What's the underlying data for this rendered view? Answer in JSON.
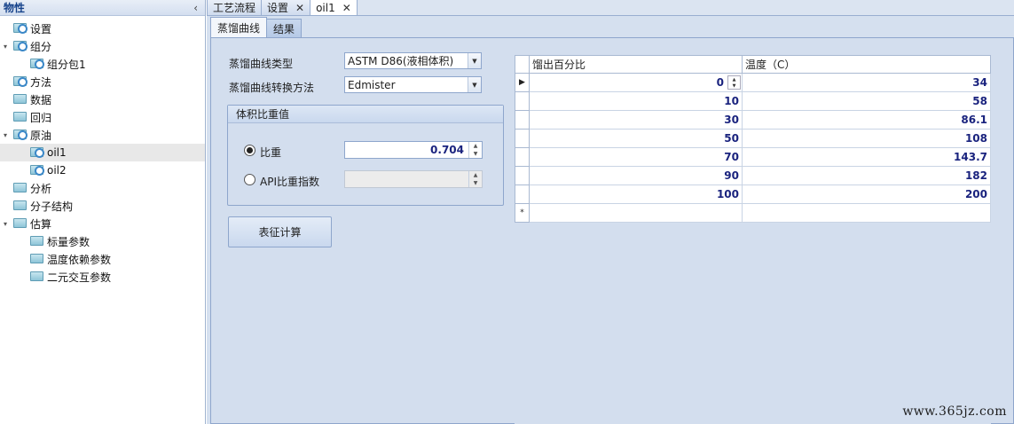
{
  "left_panel": {
    "title": "物性",
    "collapse_glyph": "‹",
    "tree": [
      {
        "label": "设置",
        "level": 0,
        "expander": "",
        "icon": "folder-gear-icon"
      },
      {
        "label": "组分",
        "level": 0,
        "expander": "▾",
        "icon": "folder-gear-icon"
      },
      {
        "label": "组分包1",
        "level": 1,
        "expander": "",
        "icon": "folder-gear-icon"
      },
      {
        "label": "方法",
        "level": 0,
        "expander": "",
        "icon": "folder-gear-icon"
      },
      {
        "label": "数据",
        "level": 0,
        "expander": "",
        "icon": "folder-icon"
      },
      {
        "label": "回归",
        "level": 0,
        "expander": "",
        "icon": "folder-icon"
      },
      {
        "label": "原油",
        "level": 0,
        "expander": "▾",
        "icon": "folder-gear-icon"
      },
      {
        "label": "oil1",
        "level": 1,
        "expander": "",
        "icon": "folder-gear-icon",
        "selected": true
      },
      {
        "label": "oil2",
        "level": 1,
        "expander": "",
        "icon": "folder-gear-icon"
      },
      {
        "label": "分析",
        "level": 0,
        "expander": "",
        "icon": "folder-icon"
      },
      {
        "label": "分子结构",
        "level": 0,
        "expander": "",
        "icon": "folder-icon"
      },
      {
        "label": "估算",
        "level": 0,
        "expander": "▾",
        "icon": "folder-icon"
      },
      {
        "label": "标量参数",
        "level": 1,
        "expander": "",
        "icon": "folder-icon"
      },
      {
        "label": "温度依赖参数",
        "level": 1,
        "expander": "",
        "icon": "folder-icon"
      },
      {
        "label": "二元交互参数",
        "level": 1,
        "expander": "",
        "icon": "folder-icon"
      }
    ]
  },
  "doc_tabs": [
    {
      "label": "工艺流程",
      "closable": false,
      "active": false
    },
    {
      "label": "设置",
      "closable": true,
      "active": false
    },
    {
      "label": "oil1",
      "closable": true,
      "active": true
    }
  ],
  "close_glyph": "✕",
  "sub_tabs": [
    {
      "label": "蒸馏曲线",
      "active": true
    },
    {
      "label": "结果",
      "active": false
    }
  ],
  "form": {
    "curve_type_label": "蒸馏曲线类型",
    "curve_type_value": "ASTM D86(液相体积)",
    "convert_method_label": "蒸馏曲线转换方法",
    "convert_method_value": "Edmister",
    "group_title": "体积比重值",
    "sg_label": "比重",
    "sg_value": "0.704",
    "sg_selected": true,
    "api_label": "API比重指数",
    "api_value": "",
    "calc_button": "表征计算"
  },
  "grid": {
    "columns": [
      "馏出百分比",
      "温度（C）"
    ],
    "rows": [
      {
        "marker": "▶",
        "pct": "0",
        "temp": "34",
        "editing": true
      },
      {
        "marker": "",
        "pct": "10",
        "temp": "58"
      },
      {
        "marker": "",
        "pct": "30",
        "temp": "86.1"
      },
      {
        "marker": "",
        "pct": "50",
        "temp": "108"
      },
      {
        "marker": "",
        "pct": "70",
        "temp": "143.7"
      },
      {
        "marker": "",
        "pct": "90",
        "temp": "182"
      },
      {
        "marker": "",
        "pct": "100",
        "temp": "200"
      },
      {
        "marker": "*",
        "pct": "",
        "temp": ""
      }
    ]
  },
  "watermark": "www.365jz.com",
  "colors": {
    "value_text": "#1a237e",
    "panel_bg": "#d3deee",
    "border": "#8ea6cc"
  }
}
